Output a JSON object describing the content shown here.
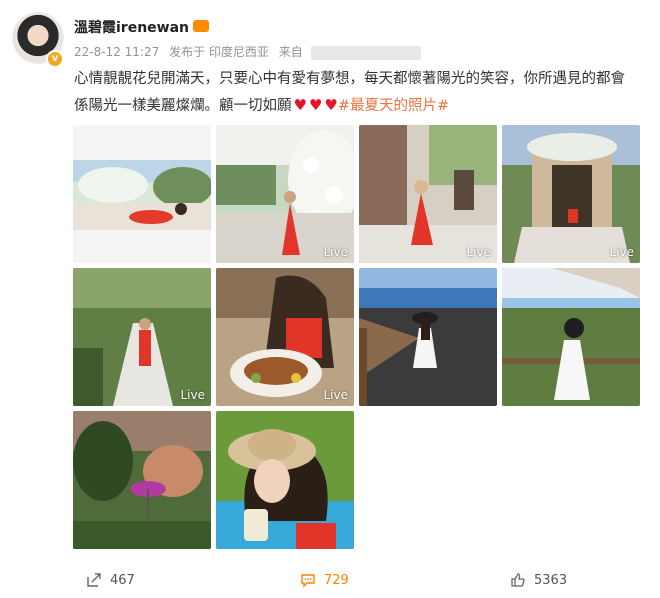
{
  "post": {
    "username": "溫碧霞irenewan",
    "date": "22-8-12 11:27",
    "posted_from": "发布于 印度尼西亚",
    "source_label": "来自",
    "text": "心情靚靚花兒開滿天，只要心中有愛有夢想，每天都懷著陽光的笑容，你所遇見的都會係陽光一樣美麗燦爛。顧一切如願",
    "hashtag": "#最夏天的照片#"
  },
  "photos": [
    {
      "live": ""
    },
    {
      "live": "Live"
    },
    {
      "live": "Live"
    },
    {
      "live": "Live"
    },
    {
      "live": "Live"
    },
    {
      "live": "Live"
    },
    {
      "live": ""
    },
    {
      "live": ""
    },
    {
      "live": ""
    },
    {
      "live": ""
    }
  ],
  "actions": {
    "share_count": "467",
    "comment_count": "729",
    "like_count": "5363"
  },
  "colors": {
    "hashtag": "#eb7340",
    "comment_active": "#ff8200",
    "verified": "#f5a623",
    "heart": "#e5162b"
  },
  "icons": {
    "share": "share-icon",
    "comment": "comment-icon",
    "like": "thumbs-up-icon"
  }
}
